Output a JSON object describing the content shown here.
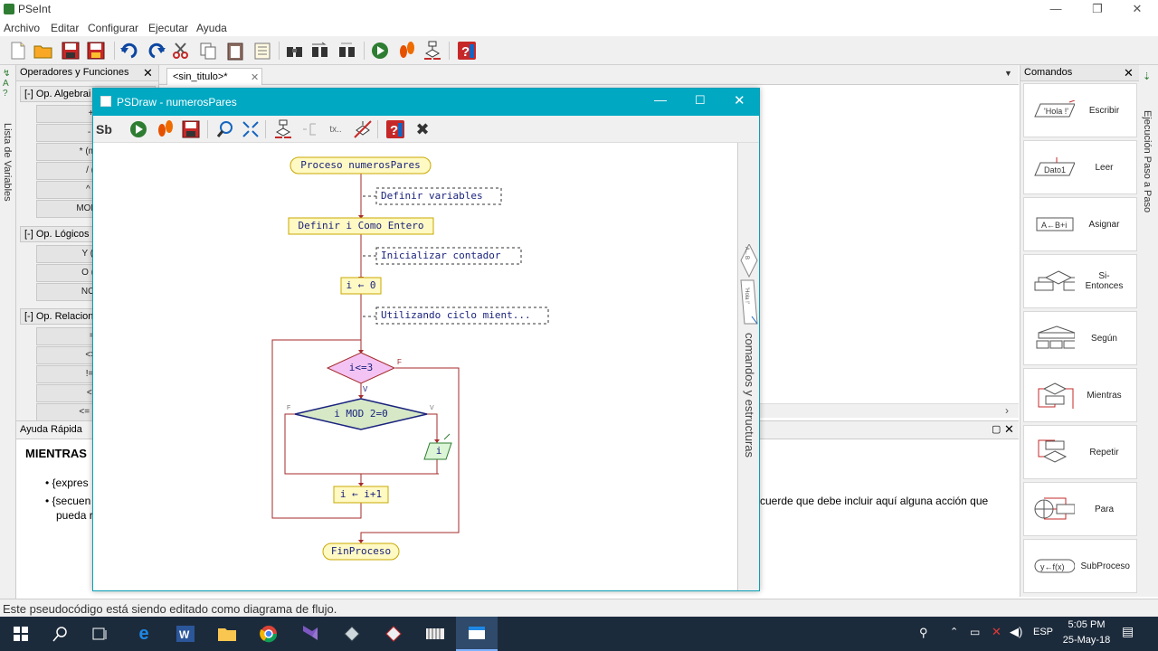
{
  "app": {
    "title": "PSeInt"
  },
  "window_controls": {
    "minimize": "—",
    "restore": "❐",
    "close": "✕"
  },
  "menu": [
    "Archivo",
    "Editar",
    "Configurar",
    "Ejecutar",
    "Ayuda"
  ],
  "left_strip": {
    "label": "Lista de Variables"
  },
  "operators_panel": {
    "title": "Operadores y Funciones",
    "groups": [
      {
        "label": "[-]  Op. Algebrai",
        "items": [
          "+ (s",
          "- (re",
          "* (multip",
          "/ (div",
          "^ (po",
          "MOD (res"
        ]
      },
      {
        "label": "[-]  Op. Lógicos",
        "items": [
          "Y (conj",
          "O (disy",
          "NO (ne"
        ]
      },
      {
        "label": "[-]  Op. Relacion",
        "items": [
          "= (i",
          "<> (d",
          "!= (di",
          "< (m",
          "<= (men"
        ]
      }
    ]
  },
  "editor": {
    "tab_label": "<sin_titulo>*"
  },
  "help": {
    "title": "Ayuda Rápida",
    "heading": "MIENTRAS",
    "bullet1": "{expres",
    "bullet2": "{secuen",
    "bullet2_cont": "pueda r",
    "right_text": "cuerde que debe incluir aquí alguna acción que"
  },
  "commands_panel": {
    "title": "Comandos",
    "items": [
      {
        "label": "Escribir",
        "icon_text": "'Hola !'"
      },
      {
        "label": "Leer",
        "icon_text": "Dato1"
      },
      {
        "label": "Asignar",
        "icon_text": "A←B+i"
      },
      {
        "label": "Si-Entonces",
        "icon_text": ""
      },
      {
        "label": "Según",
        "icon_text": ""
      },
      {
        "label": "Mientras",
        "icon_text": ""
      },
      {
        "label": "Repetir",
        "icon_text": ""
      },
      {
        "label": "Para",
        "icon_text": ""
      },
      {
        "label": "SubProceso",
        "icon_text": "y←f(x)"
      }
    ]
  },
  "right_strip": {
    "label": "Ejecución Paso a Paso"
  },
  "psdraw": {
    "title": "PSDraw - numerosPares",
    "side_label": "comandos y estructuras",
    "side_icon1": "A←B",
    "side_icon2": "'Hola !'",
    "flowchart": {
      "start": "Proceso numerosPares",
      "comment1": "Definir variables",
      "define": "Definir i Como Entero",
      "comment2": "Inicializar contador",
      "assign": "i ← 0",
      "comment3": "Utilizando ciclo mient...",
      "while_cond": "i<=3",
      "while_false": "F",
      "while_true": "V",
      "if_cond": "i MOD 2=0",
      "if_false": "F",
      "if_true": "V",
      "output": "i",
      "increment": "i ← i+1",
      "end": "FinProceso"
    }
  },
  "status": {
    "text": "Este pseudocódigo está siendo editado como diagrama de flujo."
  },
  "taskbar": {
    "time": "5:05 PM",
    "date": "25-May-18",
    "lang": "ESP"
  }
}
